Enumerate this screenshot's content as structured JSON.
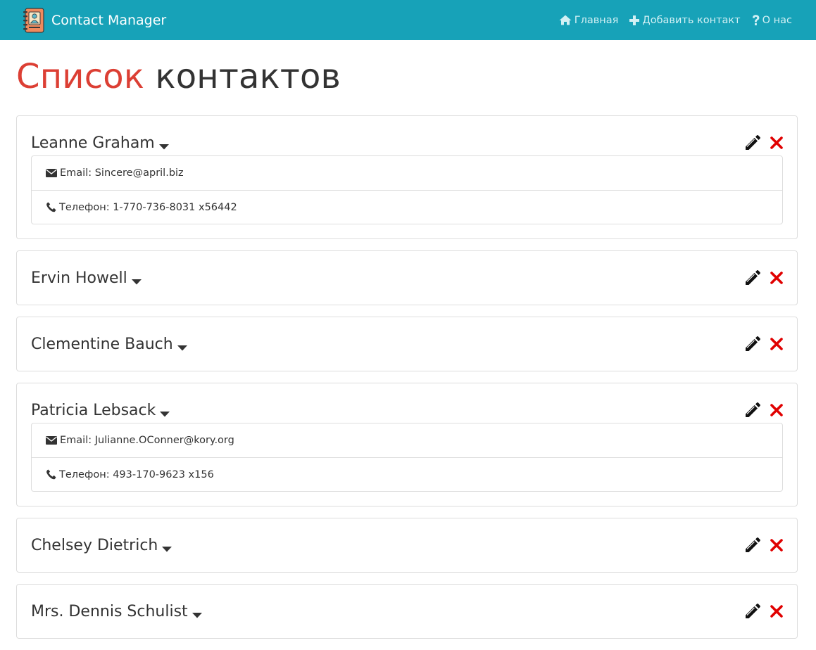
{
  "navbar": {
    "brand": "Contact Manager",
    "links": [
      {
        "label": "Главная",
        "icon": "home-icon"
      },
      {
        "label": "Добавить контакт",
        "icon": "plus-icon"
      },
      {
        "label": "О нас",
        "icon": "question-icon"
      }
    ]
  },
  "page": {
    "title_accent": "Список",
    "title_rest": "контактов"
  },
  "contacts": [
    {
      "name": "Leanne Graham",
      "expanded": true,
      "email_label": "Email: Sincere@april.biz",
      "phone_label": "Телефон: 1-770-736-8031 x56442"
    },
    {
      "name": "Ervin Howell",
      "expanded": false
    },
    {
      "name": "Clementine Bauch",
      "expanded": false
    },
    {
      "name": "Patricia Lebsack",
      "expanded": true,
      "email_label": "Email: Julianne.OConner@kory.org",
      "phone_label": "Телефон: 493-170-9623 x156"
    },
    {
      "name": "Chelsey Dietrich",
      "expanded": false
    },
    {
      "name": "Mrs. Dennis Schulist",
      "expanded": false
    }
  ],
  "colors": {
    "navbar": "#17a2b8",
    "title_accent": "#dc3f34",
    "delete": "#e00000"
  }
}
